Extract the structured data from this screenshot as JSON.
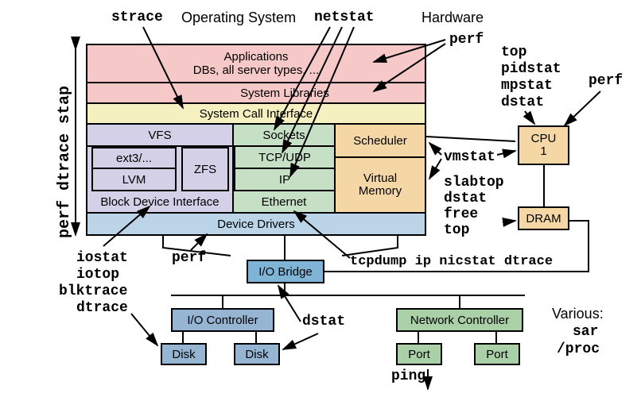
{
  "headers": {
    "os": "Operating System",
    "hw": "Hardware"
  },
  "side_tools": "perf dtrace stap",
  "os_blocks": {
    "apps_line1": "Applications",
    "apps_line2": "DBs, all server types, ...",
    "syslib": "System Libraries",
    "sci": "System Call Interface",
    "vfs": "VFS",
    "sockets": "Sockets",
    "scheduler": "Scheduler",
    "ext3": "ext3/...",
    "zfs": "ZFS",
    "tcpudp": "TCP/UDP",
    "lvm": "LVM",
    "ip": "IP",
    "vmem_l1": "Virtual",
    "vmem_l2": "Memory",
    "bdi": "Block Device Interface",
    "eth": "Ethernet",
    "drivers": "Device Drivers"
  },
  "hw_blocks": {
    "cpu_l1": "CPU",
    "cpu_l2": "1",
    "dram": "DRAM",
    "iobridge": "I/O Bridge",
    "ioctrl": "I/O Controller",
    "netctrl": "Network Controller",
    "disk": "Disk",
    "port": "Port"
  },
  "tools": {
    "strace": "strace",
    "netstat": "netstat",
    "perf": "perf",
    "top": "top",
    "pidstat": "pidstat",
    "mpstat": "mpstat",
    "dstat": "dstat",
    "vmstat": "vmstat",
    "slabtop": "slabtop",
    "free": "free",
    "iostat": "iostat",
    "iotop": "iotop",
    "blktrace": "blktrace",
    "dtrace": "dtrace",
    "tcpdump_etc": "tcpdump ip nicstat dtrace",
    "various": "Various:",
    "sar": "sar",
    "proc": "/proc",
    "ping": "ping"
  }
}
